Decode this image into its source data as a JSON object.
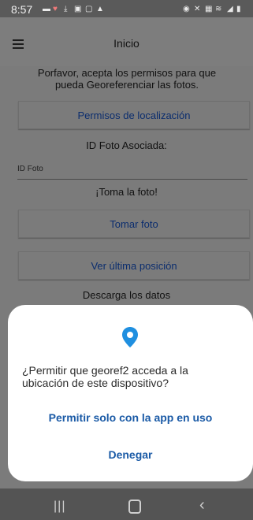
{
  "status_bar": {
    "time": "8:57",
    "left_icons": [
      "chat-icon",
      "heart-icon",
      "download-icon",
      "image-icon",
      "photo-icon",
      "cloud-icon"
    ],
    "right_icons": [
      "alarm-icon",
      "mute-icon",
      "lock-icon",
      "wifi-icon",
      "signal-icon",
      "battery-icon"
    ]
  },
  "app_bar": {
    "title": "Inicio",
    "menu_icon": "hamburger-icon"
  },
  "content": {
    "permission_msg": "Porfavor, acepta los permisos para que pueda Georeferenciar las fotos.",
    "permissions_button": "Permisos de localización",
    "photo_id_heading": "ID Foto Asociada:",
    "photo_id_label": "ID Foto",
    "take_photo_heading": "¡Toma la foto!",
    "take_photo_button": "Tomar foto",
    "last_position_button": "Ver última posición",
    "download_heading": "Descarga los datos"
  },
  "dialog": {
    "icon": "location-pin-icon",
    "message": "¿Permitir que georef2 acceda a la ubicación de este dispositivo?",
    "allow_label": "Permitir solo con la app en uso",
    "deny_label": "Denegar"
  },
  "nav_bar": {
    "icons": [
      "recents-icon",
      "home-icon",
      "back-icon"
    ]
  },
  "colors": {
    "accent": "#1a5aa6",
    "pin": "#1f8fe0",
    "scrim": "#7b7b7b",
    "dialog_bg": "#ffffff"
  }
}
